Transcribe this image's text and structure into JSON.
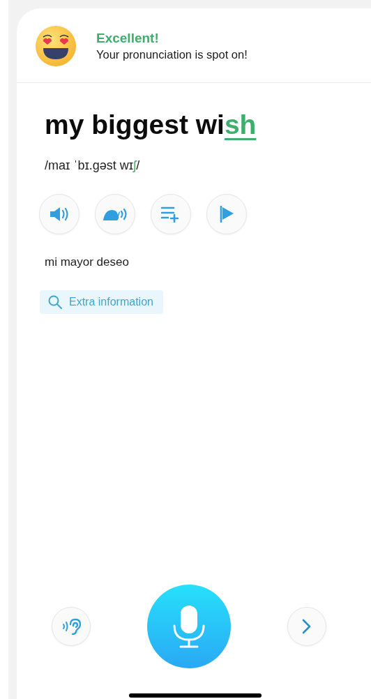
{
  "feedback": {
    "title": "Excellent!",
    "message": "Your pronunciation is spot on!"
  },
  "phrase": {
    "parts": [
      {
        "text": "my biggest wi",
        "highlighted": false
      },
      {
        "text": "sh",
        "highlighted": true
      }
    ]
  },
  "phonetic": {
    "parts": [
      {
        "text": "/maɪ ˈbɪ.gəst wɪ",
        "highlighted": false
      },
      {
        "text": "ʃ",
        "highlighted": true
      },
      {
        "text": "/",
        "highlighted": false
      }
    ]
  },
  "actions": [
    {
      "kind": "speaker"
    },
    {
      "kind": "slow"
    },
    {
      "kind": "add-list"
    },
    {
      "kind": "flag"
    }
  ],
  "translation": "mi mayor deseo",
  "extra_button": {
    "label": "Extra information"
  },
  "controls": [
    {
      "kind": "listen"
    },
    {
      "kind": "mic"
    },
    {
      "kind": "next"
    }
  ]
}
